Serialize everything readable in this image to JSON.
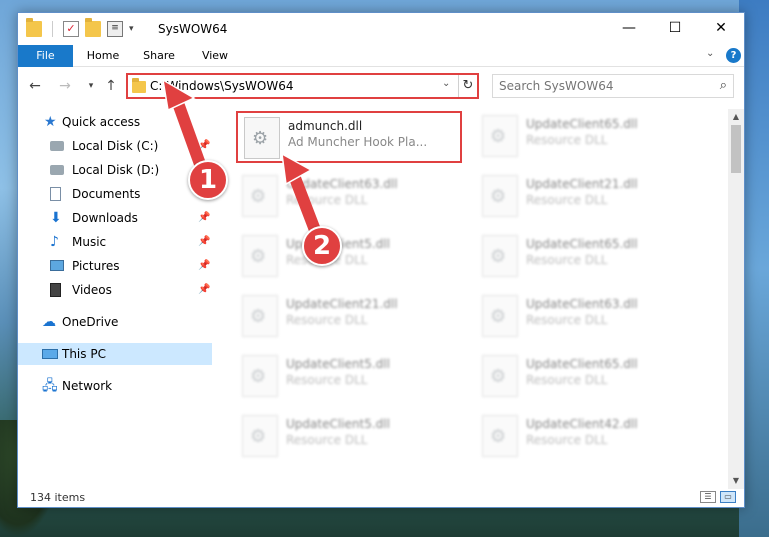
{
  "window": {
    "title": "SysWOW64"
  },
  "ribbon": {
    "tabs": [
      "File",
      "Home",
      "Share",
      "View"
    ]
  },
  "address": {
    "path": "C:\\Windows\\SysWOW64"
  },
  "search": {
    "placeholder": "Search SysWOW64"
  },
  "sidebar": {
    "items": [
      {
        "label": "Quick access",
        "icon": "star-icon"
      },
      {
        "label": "Local Disk (C:)",
        "icon": "disk-icon"
      },
      {
        "label": "Local Disk (D:)",
        "icon": "disk-icon"
      },
      {
        "label": "Documents",
        "icon": "documents-icon"
      },
      {
        "label": "Downloads",
        "icon": "download-icon"
      },
      {
        "label": "Music",
        "icon": "music-icon"
      },
      {
        "label": "Pictures",
        "icon": "pictures-icon"
      },
      {
        "label": "Videos",
        "icon": "videos-icon"
      },
      {
        "label": "OneDrive",
        "icon": "cloud-icon"
      },
      {
        "label": "This PC",
        "icon": "pc-icon"
      },
      {
        "label": "Network",
        "icon": "network-icon"
      }
    ]
  },
  "files": [
    {
      "name": "admunch.dll",
      "desc": "Ad Muncher Hook Pla..."
    },
    {
      "name": "UpdateClient65.dll",
      "desc": "Resource DLL"
    },
    {
      "name": "UpdateClient63.dll",
      "desc": "Resource DLL"
    },
    {
      "name": "UpdateClient21.dll",
      "desc": "Resource DLL"
    },
    {
      "name": "UpdateClient5.dll",
      "desc": "Resource DLL"
    },
    {
      "name": "UpdateClient65.dll",
      "desc": "Resource DLL"
    },
    {
      "name": "UpdateClient21.dll",
      "desc": "Resource DLL"
    },
    {
      "name": "UpdateClient63.dll",
      "desc": "Resource DLL"
    },
    {
      "name": "UpdateClient5.dll",
      "desc": "Resource DLL"
    },
    {
      "name": "UpdateClient65.dll",
      "desc": "Resource DLL"
    },
    {
      "name": "UpdateClient5.dll",
      "desc": "Resource DLL"
    },
    {
      "name": "UpdateClient42.dll",
      "desc": "Resource DLL"
    }
  ],
  "status": {
    "item_count": "134 items"
  },
  "callouts": {
    "one": "1",
    "two": "2"
  },
  "colors": {
    "accent": "#1979ca",
    "highlight": "#e04040",
    "selection": "#cce8ff"
  }
}
